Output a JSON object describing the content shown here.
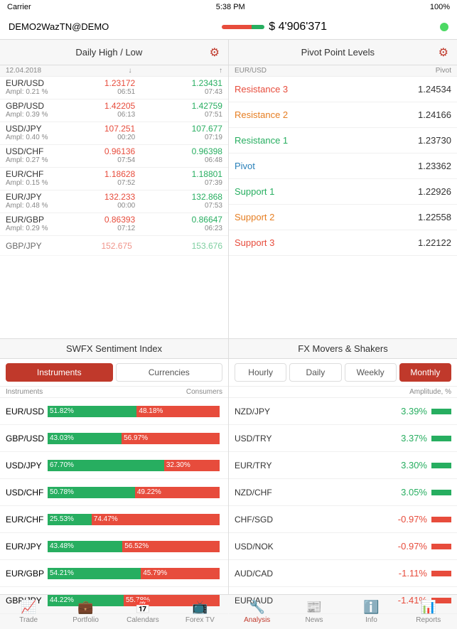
{
  "statusBar": {
    "carrier": "Carrier",
    "wifi": "📶",
    "time": "5:38 PM",
    "battery": "100%"
  },
  "accountBar": {
    "accountName": "DEMO2WazTN@DEMO",
    "balance": "$ 4'906'371",
    "statusColor": "#4cd964"
  },
  "leftPanel": {
    "title": "Daily High / Low",
    "tableHeader": {
      "date": "12.04.2018",
      "downArrow": "↓",
      "upArrow": "↑"
    },
    "rows": [
      {
        "pair": "EUR/USD",
        "ampl": "Ampl: 0.21 %",
        "lowVal": "1.23172",
        "lowTime": "06:51",
        "highVal": "1.23431",
        "highTime": "07:43"
      },
      {
        "pair": "GBP/USD",
        "ampl": "Ampl: 0.39 %",
        "lowVal": "1.42205",
        "lowTime": "06:13",
        "highVal": "1.42759",
        "highTime": "07:51"
      },
      {
        "pair": "USD/JPY",
        "ampl": "Ampl: 0.40 %",
        "lowVal": "107.251",
        "lowTime": "00:20",
        "highVal": "107.677",
        "highTime": "07:19"
      },
      {
        "pair": "USD/CHF",
        "ampl": "Ampl: 0.27 %",
        "lowVal": "0.96136",
        "lowTime": "07:54",
        "highVal": "0.96398",
        "highTime": "06:48"
      },
      {
        "pair": "EUR/CHF",
        "ampl": "Ampl: 0.15 %",
        "lowVal": "1.18628",
        "lowTime": "07:52",
        "highVal": "1.18801",
        "highTime": "07:39"
      },
      {
        "pair": "EUR/JPY",
        "ampl": "Ampl: 0.48 %",
        "lowVal": "132.233",
        "lowTime": "00:00",
        "highVal": "132.868",
        "highTime": "07:53"
      },
      {
        "pair": "EUR/GBP",
        "ampl": "Ampl: 0.29 %",
        "lowVal": "0.86393",
        "lowTime": "07:12",
        "highVal": "0.86647",
        "highTime": "06:23"
      },
      {
        "pair": "GBP/JPY",
        "ampl": "",
        "lowVal": "152.675",
        "lowTime": "",
        "highVal": "153.676",
        "highTime": ""
      }
    ]
  },
  "rightPanel": {
    "title": "Pivot Point Levels",
    "tableHeader": {
      "pair": "EUR/USD",
      "label": "Pivot"
    },
    "rows": [
      {
        "label": "Resistance 3",
        "labelClass": "res3",
        "value": "1.24534"
      },
      {
        "label": "Resistance 2",
        "labelClass": "res2",
        "value": "1.24166"
      },
      {
        "label": "Resistance 1",
        "labelClass": "res1",
        "value": "1.23730"
      },
      {
        "label": "Pivot",
        "labelClass": "pivot-blue",
        "value": "1.23362"
      },
      {
        "label": "Support 1",
        "labelClass": "sup1",
        "value": "1.22926"
      },
      {
        "label": "Support 2",
        "labelClass": "sup2",
        "value": "1.22558"
      },
      {
        "label": "Support 3",
        "labelClass": "sup3",
        "value": "1.22122"
      }
    ]
  },
  "sentimentPanel": {
    "title": "SWFX Sentiment Index",
    "tabs": [
      {
        "label": "Instruments",
        "active": true
      },
      {
        "label": "Currencies",
        "active": false
      }
    ],
    "header": {
      "instruments": "Instruments",
      "consumers": "Consumers"
    },
    "rows": [
      {
        "pair": "EUR/USD",
        "greenPct": 51.82,
        "redPct": 48.18,
        "greenLabel": "51.82%",
        "redLabel": "48.18%"
      },
      {
        "pair": "GBP/USD",
        "greenPct": 43.03,
        "redPct": 56.97,
        "greenLabel": "43.03%",
        "redLabel": "56.97%"
      },
      {
        "pair": "USD/JPY",
        "greenPct": 67.7,
        "redPct": 32.3,
        "greenLabel": "67.70%",
        "redLabel": "32.30%"
      },
      {
        "pair": "USD/CHF",
        "greenPct": 50.78,
        "redPct": 49.22,
        "greenLabel": "50.78%",
        "redLabel": "49.22%"
      },
      {
        "pair": "EUR/CHF",
        "greenPct": 25.53,
        "redPct": 74.47,
        "greenLabel": "25.53%",
        "redLabel": "74.47%"
      },
      {
        "pair": "EUR/JPY",
        "greenPct": 43.48,
        "redPct": 56.52,
        "greenLabel": "43.48%",
        "redLabel": "56.52%"
      },
      {
        "pair": "EUR/GBP",
        "greenPct": 54.21,
        "redPct": 45.79,
        "greenLabel": "54.21%",
        "redLabel": "45.79%"
      },
      {
        "pair": "GBP/JPY",
        "greenPct": 44.22,
        "redPct": 55.78,
        "greenLabel": "44.22%",
        "redLabel": "55.78%"
      }
    ]
  },
  "moversPanel": {
    "title": "FX Movers & Shakers",
    "tabs": [
      {
        "label": "Hourly",
        "active": false
      },
      {
        "label": "Daily",
        "active": false
      },
      {
        "label": "Weekly",
        "active": false
      },
      {
        "label": "Monthly",
        "active": true
      }
    ],
    "header": {
      "amplitude": "Amplitude, %"
    },
    "rows": [
      {
        "pair": "NZD/JPY",
        "value": "3.39%",
        "positive": true
      },
      {
        "pair": "USD/TRY",
        "value": "3.37%",
        "positive": true
      },
      {
        "pair": "EUR/TRY",
        "value": "3.30%",
        "positive": true
      },
      {
        "pair": "NZD/CHF",
        "value": "3.05%",
        "positive": true
      },
      {
        "pair": "CHF/SGD",
        "value": "-0.97%",
        "positive": false
      },
      {
        "pair": "USD/NOK",
        "value": "-0.97%",
        "positive": false
      },
      {
        "pair": "AUD/CAD",
        "value": "-1.11%",
        "positive": false
      },
      {
        "pair": "EUR/AUD",
        "value": "-1.41%",
        "positive": false
      }
    ]
  },
  "bottomNav": {
    "items": [
      {
        "label": "Trade",
        "icon": "📈",
        "active": false
      },
      {
        "label": "Portfolio",
        "icon": "💼",
        "active": false
      },
      {
        "label": "Calendars",
        "icon": "📅",
        "active": false
      },
      {
        "label": "Forex TV",
        "icon": "📺",
        "active": false
      },
      {
        "label": "Analysis",
        "icon": "🔧",
        "active": true
      },
      {
        "label": "News",
        "icon": "📰",
        "active": false
      },
      {
        "label": "Info",
        "icon": "ℹ️",
        "active": false
      },
      {
        "label": "Reports",
        "icon": "📊",
        "active": false
      }
    ]
  }
}
